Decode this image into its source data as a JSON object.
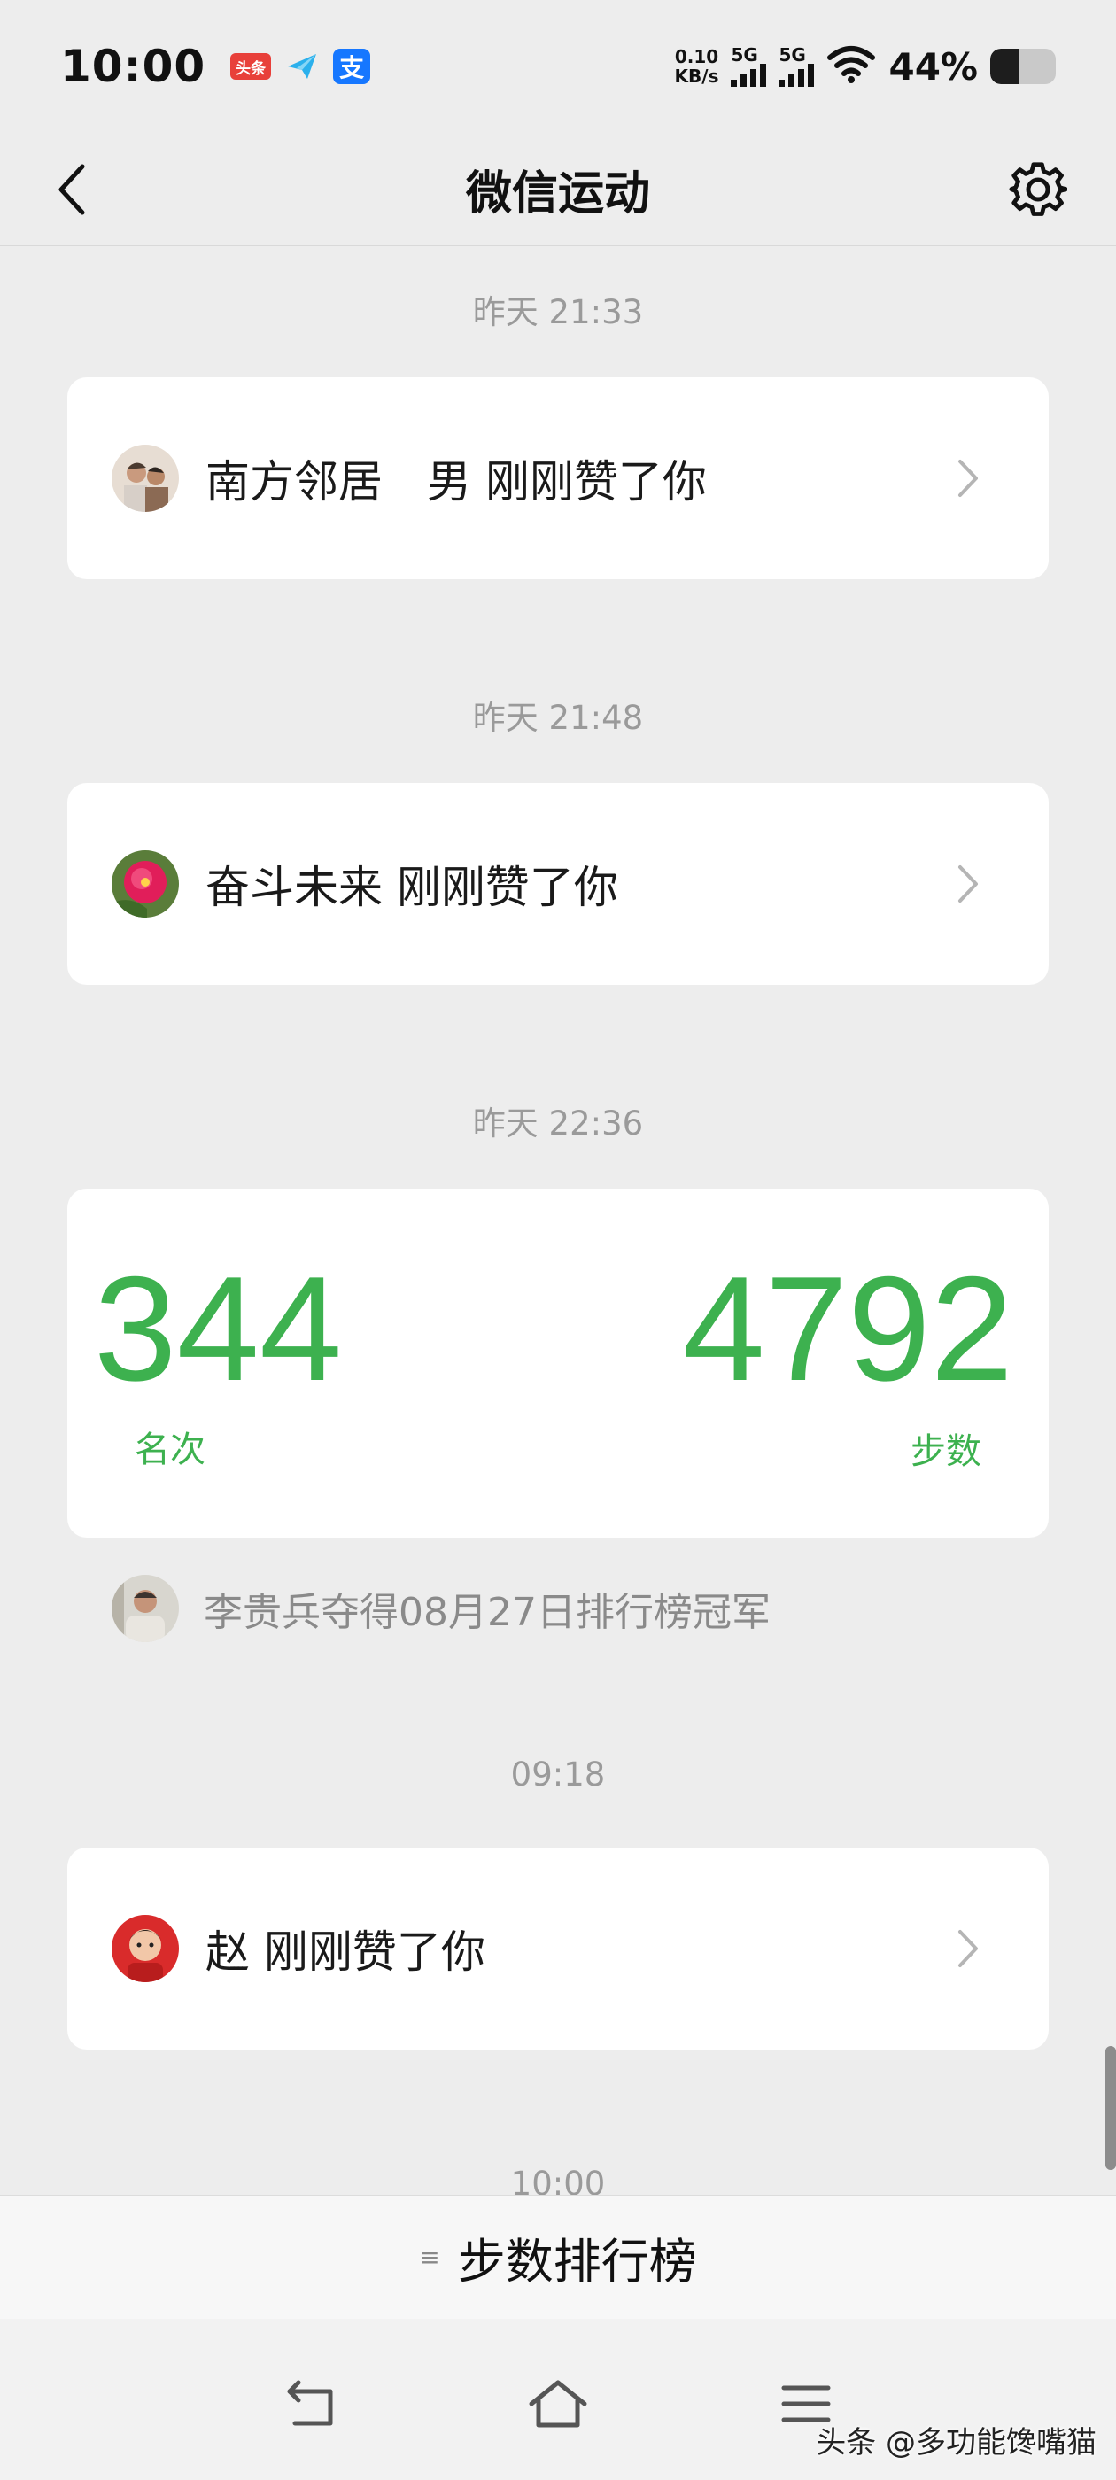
{
  "status_bar": {
    "time": "10:00",
    "net_speed_value": "0.10",
    "net_speed_unit": "KB/s",
    "sim1_label": "5G",
    "sim2_label": "5G",
    "battery_text": "44%",
    "battery_level": 0.44,
    "notif_icons": [
      "toutiao-icon",
      "plane-icon",
      "alipay-icon"
    ],
    "toutiao_label": "头条",
    "alipay_label": "支"
  },
  "nav": {
    "title": "微信运动",
    "back_icon": "chevron-left-icon",
    "settings_icon": "gear-icon"
  },
  "feed": {
    "items": [
      {
        "timestamp": "昨天 21:33",
        "text": "南方邻居　男 刚刚赞了你"
      },
      {
        "timestamp": "昨天 21:48",
        "text": "奋斗未来 刚刚赞了你"
      },
      {
        "timestamp": "昨天 22:36",
        "rank_value": "344",
        "rank_label": "名次",
        "steps_value": "4792",
        "steps_label": "步数",
        "champion_text": "李贵兵夺得08月27日排行榜冠军"
      },
      {
        "timestamp": "09:18",
        "text": "赵 刚刚赞了你"
      },
      {
        "timestamp": "10:00"
      }
    ]
  },
  "leaderboard": {
    "label": "步数排行榜"
  },
  "system_nav": {
    "back_icon": "return-icon",
    "home_icon": "home-icon",
    "menu_icon": "menu-icon"
  },
  "watermark": "头条 @多功能馋嘴猫",
  "colors": {
    "accent_green": "#3db14f",
    "background": "#ededed",
    "card": "#ffffff"
  }
}
